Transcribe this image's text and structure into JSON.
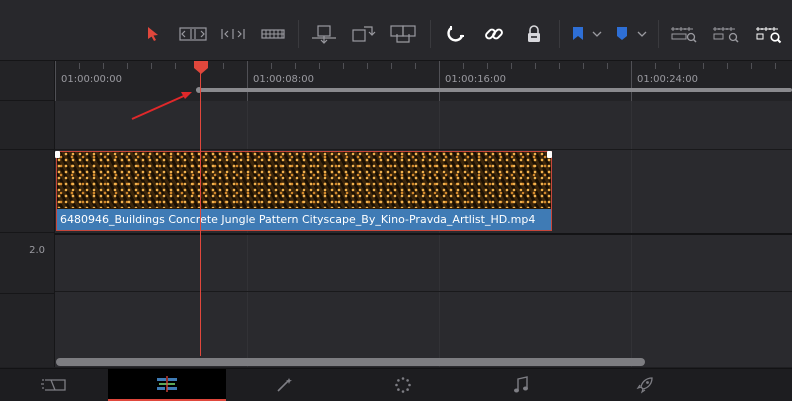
{
  "toolbar": {
    "tools": [
      {
        "icon": "selection-arrow-icon",
        "color": "#e0473c"
      },
      {
        "icon": "trim-edit-icon"
      },
      {
        "icon": "dynamic-trim-icon"
      },
      {
        "icon": "blade-edit-icon"
      },
      {
        "icon": "insert-clip-icon"
      },
      {
        "icon": "overwrite-clip-icon"
      },
      {
        "icon": "replace-clip-icon"
      },
      {
        "icon": "snapping-magnet-icon"
      },
      {
        "icon": "linked-selection-icon"
      },
      {
        "icon": "position-lock-icon"
      },
      {
        "icon": "flag-icon",
        "color": "#2e6fd6"
      },
      {
        "icon": "marker-icon",
        "color": "#2e6fd6"
      },
      {
        "icon": "zoom-full-icon"
      },
      {
        "icon": "zoom-detail-icon"
      },
      {
        "icon": "zoom-custom-icon"
      }
    ]
  },
  "ruler": {
    "timecodes": [
      "01:00:00:00",
      "01:00:08:00",
      "01:00:16:00",
      "01:00:24:00"
    ]
  },
  "audio_track": {
    "level": "2.0"
  },
  "clip": {
    "name": "6480946_Buildings Concrete Jungle Pattern Cityscape_By_Kino-Pravda_Artlist_HD.mp4",
    "label_color": "#3f7bb5",
    "border_color": "#c7463a"
  },
  "footer": {
    "pages": [
      {
        "name": "cut-page-icon"
      },
      {
        "name": "edit-page-icon",
        "active": true
      },
      {
        "name": "fusion-page-icon"
      },
      {
        "name": "color-page-icon"
      },
      {
        "name": "fairlight-page-icon"
      },
      {
        "name": "deliver-page-icon"
      }
    ]
  },
  "colors": {
    "playhead": "#e0473c",
    "accent_blue": "#2e6fd6"
  }
}
